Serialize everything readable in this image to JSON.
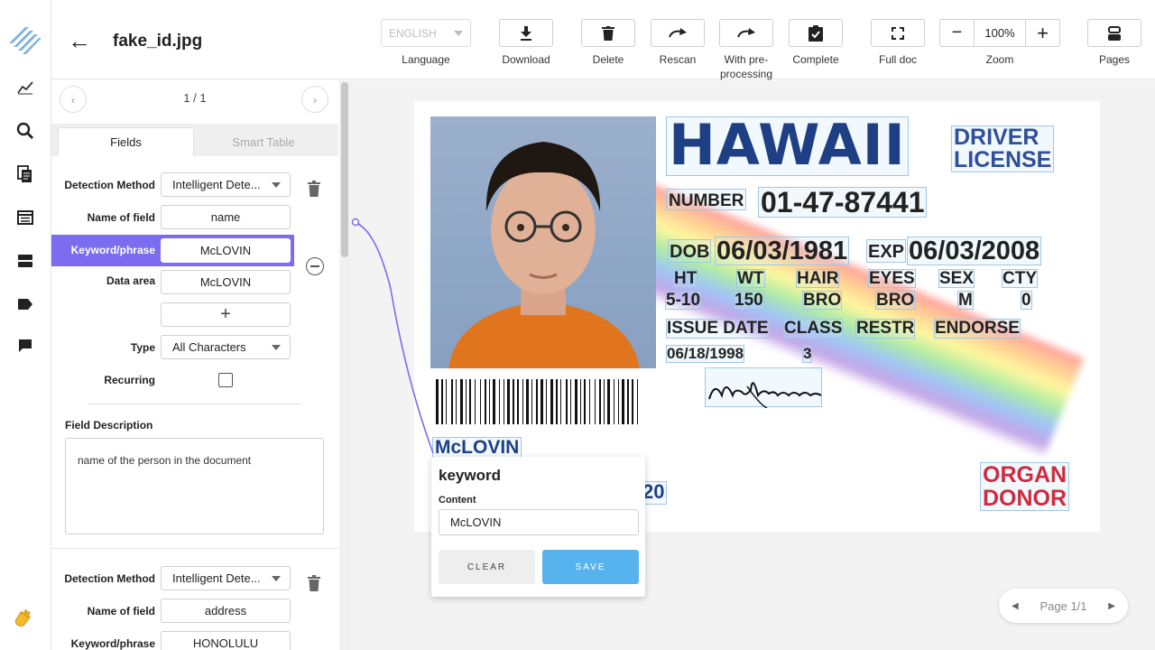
{
  "app": {
    "file_name": "fake_id.jpg"
  },
  "toolbar": {
    "language_value": "ENGLISH",
    "language_label": "Language",
    "download_label": "Download",
    "delete_label": "Delete",
    "rescan_label": "Rescan",
    "preprocessing_label_line1": "With pre-",
    "preprocessing_label_line2": "processing",
    "complete_label": "Complete",
    "fulldoc_label": "Full doc",
    "zoom_value": "100%",
    "zoom_minus": "−",
    "zoom_plus": "+",
    "zoom_label": "Zoom",
    "pages_label": "Pages"
  },
  "left_panel": {
    "pager": "1 / 1",
    "tabs": [
      "Fields",
      "Smart Table"
    ],
    "field1": {
      "detection_label": "Detection Method",
      "detection_value": "Intelligent Dete...",
      "name_label": "Name of field",
      "name_value": "name",
      "keyword_label": "Keyword/phrase",
      "keyword_value": "McLOVIN",
      "data_area_label": "Data area",
      "data_area_value": "McLOVIN",
      "add_symbol": "+",
      "type_label": "Type",
      "type_value": "All Characters",
      "recurring_label": "Recurring",
      "description_label": "Field Description",
      "description_value": "name of the person in the document"
    },
    "field2": {
      "detection_label": "Detection Method",
      "detection_value": "Intelligent Dete...",
      "name_label": "Name of field",
      "name_value": "address",
      "keyword_label": "Keyword/phrase",
      "keyword_value": "HONOLULU"
    }
  },
  "document": {
    "state": "HAWAII",
    "doc_type_line1": "DRIVER",
    "doc_type_line2": "LICENSE",
    "number_label": "NUMBER",
    "number_value": "01-47-87441",
    "dob_label": "DOB",
    "dob_value": "06/03/1981",
    "exp_label": "EXP",
    "exp_value": "06/03/2008",
    "attr_labels": [
      "HT",
      "WT",
      "HAIR",
      "EYES",
      "SEX",
      "CTY"
    ],
    "attr_values": [
      "5-10",
      "150",
      "BRO",
      "BRO",
      "M",
      "0"
    ],
    "issue_labels": [
      "ISSUE DATE",
      "CLASS",
      "RESTR",
      "ENDORSE"
    ],
    "issue_values": [
      "06/18/1998",
      "3"
    ],
    "organ_line1": "ORGAN",
    "organ_line2": "DONOR",
    "name_text": "McLOVIN",
    "partial_text": "20"
  },
  "popup": {
    "title": "keyword",
    "content_label": "Content",
    "content_value": "McLOVIN",
    "clear_label": "CLEAR",
    "save_label": "SAVE"
  },
  "page_nav": {
    "label": "Page 1/1"
  }
}
